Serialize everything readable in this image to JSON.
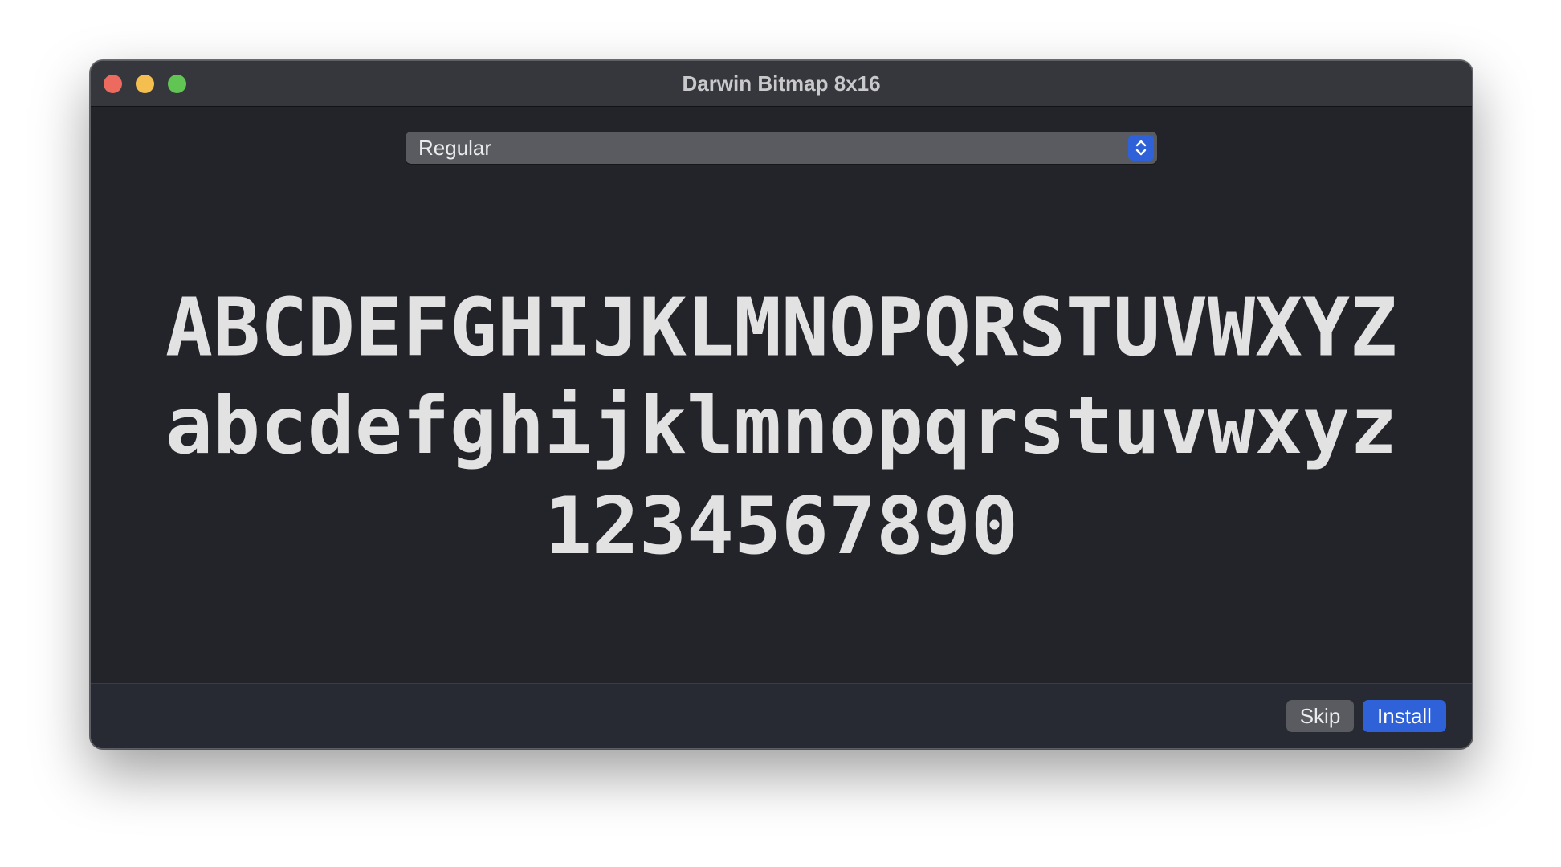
{
  "window": {
    "title": "Darwin Bitmap 8x16"
  },
  "style_popup": {
    "selected": "Regular",
    "icon": "chevron-up-down-icon"
  },
  "sample": {
    "uppercase": "ABCDEFGHIJKLMNOPQRSTUVWXYZ",
    "lowercase": "abcdefghijklmnopqrstuvwxyz",
    "digits": "1234567890"
  },
  "footer": {
    "skip_label": "Skip",
    "install_label": "Install"
  },
  "colors": {
    "accent": "#2f62d8",
    "close": "#ed6a5e",
    "minimize": "#f5bf4f",
    "zoom": "#61c554"
  }
}
